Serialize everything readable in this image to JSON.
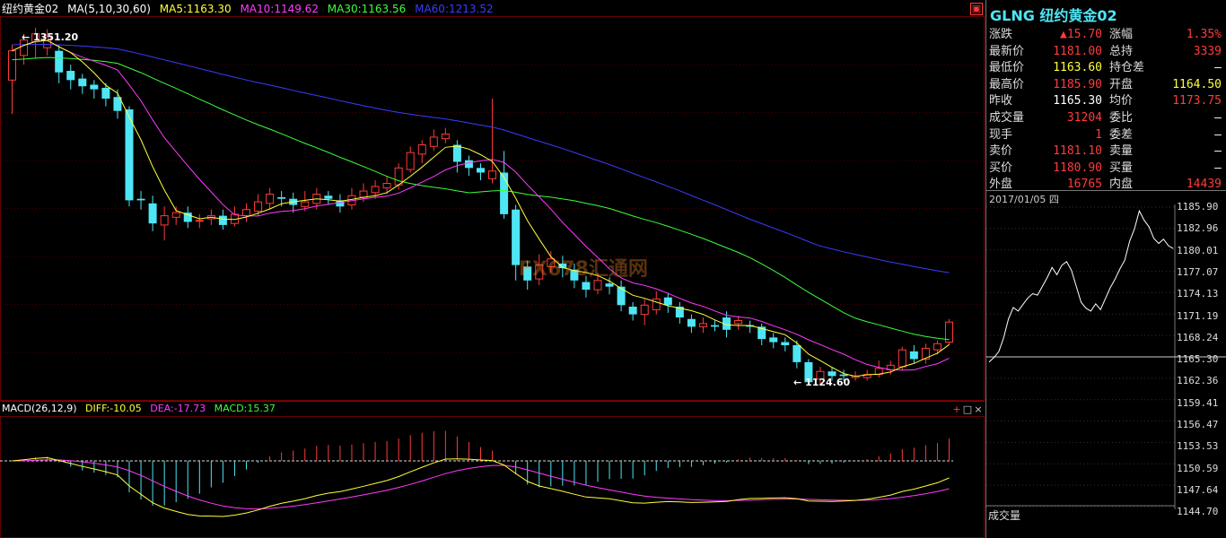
{
  "header": {
    "symbol": "纽约黄金02",
    "ma_label": "MA(5,10,30,60)",
    "ma5": "MA5:1163.30",
    "ma10": "MA10:1149.62",
    "ma30": "MA30:1163.56",
    "ma60": "MA60:1213.52"
  },
  "annotations": {
    "high": "1351.20",
    "low": "1124.60"
  },
  "macd": {
    "label": "MACD(26,12,9)",
    "diff": "DIFF:-10.05",
    "dea": "DEA:-17.73",
    "macd": "MACD:15.37"
  },
  "colors": {
    "up": "#ff3b3b",
    "down": "#4ee6f5",
    "ma5": "#ffff3a",
    "ma10": "#ff3bff",
    "ma30": "#3bff3b",
    "ma60": "#3b3bff"
  },
  "watermark": "FX678汇通网",
  "info": {
    "title": "GLNG 纽约黄金02",
    "rows": [
      {
        "l1": "涨跌",
        "v1": "▲15.70",
        "c1": "red",
        "l2": "涨幅",
        "v2": "1.35%",
        "c2": "red"
      },
      {
        "l1": "最新价",
        "v1": "1181.00",
        "c1": "red",
        "l2": "总持",
        "v2": "3339",
        "c2": "red"
      },
      {
        "l1": "最低价",
        "v1": "1163.60",
        "c1": "yellow",
        "l2": "持仓差",
        "v2": "—",
        "c2": "white"
      },
      {
        "l1": "最高价",
        "v1": "1185.90",
        "c1": "red",
        "l2": "开盘",
        "v2": "1164.50",
        "c2": "yellow"
      },
      {
        "l1": "昨收",
        "v1": "1165.30",
        "c1": "white",
        "l2": "均价",
        "v2": "1173.75",
        "c2": "red"
      },
      {
        "l1": "成交量",
        "v1": "31204",
        "c1": "red",
        "l2": "委比",
        "v2": "—",
        "c2": "white"
      },
      {
        "l1": "现手",
        "v1": "1",
        "c1": "red",
        "l2": "委差",
        "v2": "—",
        "c2": "white"
      },
      {
        "l1": "卖价",
        "v1": "1181.10",
        "c1": "red",
        "l2": "卖量",
        "v2": "—",
        "c2": "white"
      },
      {
        "l1": "买价",
        "v1": "1180.90",
        "c1": "red",
        "l2": "买量",
        "v2": "—",
        "c2": "white"
      },
      {
        "l1": "外盘",
        "v1": "16765",
        "c1": "red",
        "l2": "内盘",
        "v2": "14439",
        "c2": "red"
      }
    ],
    "tick_date": "2017/01/05 四",
    "tick_labels": [
      "1185.90",
      "1182.96",
      "1180.01",
      "1177.07",
      "1174.13",
      "1171.19",
      "1168.24",
      "1165.30",
      "1162.36",
      "1159.41",
      "1156.47",
      "1153.53",
      "1150.59",
      "1147.64",
      "1144.70"
    ],
    "volume_label": "成交量"
  },
  "chart_data": {
    "type": "candlestick",
    "title": "纽约黄金02",
    "candles": [
      [
        1322,
        1341,
        1300,
        1345
      ],
      [
        1338,
        1348,
        1332,
        1352
      ],
      [
        1347,
        1352,
        1336,
        1356
      ],
      [
        1343,
        1350,
        1338,
        1355
      ],
      [
        1341,
        1327,
        1320,
        1345
      ],
      [
        1328,
        1322,
        1316,
        1332
      ],
      [
        1323,
        1318,
        1313,
        1326
      ],
      [
        1319,
        1316,
        1310,
        1322
      ],
      [
        1317,
        1310,
        1305,
        1320
      ],
      [
        1311,
        1302,
        1297,
        1316
      ],
      [
        1303,
        1244,
        1240,
        1305
      ],
      [
        1245,
        1244,
        1238,
        1250
      ],
      [
        1242,
        1229,
        1224,
        1247
      ],
      [
        1228,
        1234,
        1218,
        1240
      ],
      [
        1233,
        1236,
        1228,
        1240
      ],
      [
        1236,
        1230,
        1226,
        1240
      ],
      [
        1231,
        1231,
        1226,
        1235
      ],
      [
        1232,
        1234,
        1228,
        1238
      ],
      [
        1234,
        1228,
        1225,
        1238
      ],
      [
        1229,
        1235,
        1227,
        1240
      ],
      [
        1234,
        1238,
        1230,
        1242
      ],
      [
        1237,
        1243,
        1234,
        1248
      ],
      [
        1242,
        1248,
        1238,
        1252
      ],
      [
        1246,
        1245,
        1240,
        1250
      ],
      [
        1245,
        1241,
        1236,
        1249
      ],
      [
        1240,
        1243,
        1237,
        1250
      ],
      [
        1242,
        1248,
        1238,
        1252
      ],
      [
        1247,
        1245,
        1241,
        1250
      ],
      [
        1244,
        1240,
        1236,
        1248
      ],
      [
        1241,
        1247,
        1238,
        1252
      ],
      [
        1246,
        1250,
        1243,
        1255
      ],
      [
        1249,
        1253,
        1245,
        1257
      ],
      [
        1252,
        1255,
        1248,
        1260
      ],
      [
        1254,
        1265,
        1251,
        1268
      ],
      [
        1264,
        1275,
        1262,
        1279
      ],
      [
        1274,
        1280,
        1268,
        1283
      ],
      [
        1279,
        1285,
        1276,
        1290
      ],
      [
        1284,
        1287,
        1281,
        1291
      ],
      [
        1280,
        1269,
        1262,
        1283
      ],
      [
        1270,
        1265,
        1260,
        1273
      ],
      [
        1265,
        1262,
        1257,
        1268
      ],
      [
        1258,
        1263,
        1255,
        1310
      ],
      [
        1262,
        1235,
        1232,
        1276
      ],
      [
        1238,
        1202,
        1192,
        1241
      ],
      [
        1201,
        1192,
        1186,
        1205
      ],
      [
        1193,
        1202,
        1189,
        1209
      ],
      [
        1201,
        1206,
        1197,
        1211
      ],
      [
        1203,
        1200,
        1194,
        1208
      ],
      [
        1199,
        1192,
        1187,
        1203
      ],
      [
        1191,
        1186,
        1181,
        1195
      ],
      [
        1186,
        1192,
        1183,
        1197
      ],
      [
        1190,
        1188,
        1183,
        1194
      ],
      [
        1188,
        1176,
        1172,
        1192
      ],
      [
        1175,
        1170,
        1166,
        1178
      ],
      [
        1170,
        1176,
        1163,
        1180
      ],
      [
        1173,
        1180,
        1170,
        1185
      ],
      [
        1181,
        1176,
        1171,
        1184
      ],
      [
        1175,
        1168,
        1164,
        1178
      ],
      [
        1167,
        1162,
        1158,
        1170
      ],
      [
        1162,
        1164,
        1158,
        1168
      ],
      [
        1163,
        1162,
        1159,
        1166
      ],
      [
        1168,
        1160,
        1155,
        1172
      ],
      [
        1164,
        1166,
        1160,
        1169
      ],
      [
        1163,
        1162,
        1158,
        1166
      ],
      [
        1162,
        1154,
        1150,
        1164
      ],
      [
        1155,
        1152,
        1148,
        1158
      ],
      [
        1152,
        1150,
        1146,
        1155
      ],
      [
        1150,
        1139,
        1135,
        1153
      ],
      [
        1139,
        1126,
        1124,
        1141
      ],
      [
        1128,
        1133,
        1125,
        1136
      ],
      [
        1133,
        1130,
        1127,
        1136
      ],
      [
        1131,
        1130,
        1127,
        1134
      ],
      [
        1129,
        1130,
        1127,
        1133
      ],
      [
        1129,
        1131,
        1127,
        1134
      ],
      [
        1131,
        1135,
        1129,
        1140
      ],
      [
        1134,
        1137,
        1131,
        1140
      ],
      [
        1136,
        1147,
        1134,
        1149
      ],
      [
        1146,
        1141,
        1138,
        1150
      ],
      [
        1141,
        1148,
        1138,
        1151
      ],
      [
        1147,
        1151,
        1144,
        1153
      ],
      [
        1152,
        1165,
        1150,
        1167
      ]
    ]
  }
}
